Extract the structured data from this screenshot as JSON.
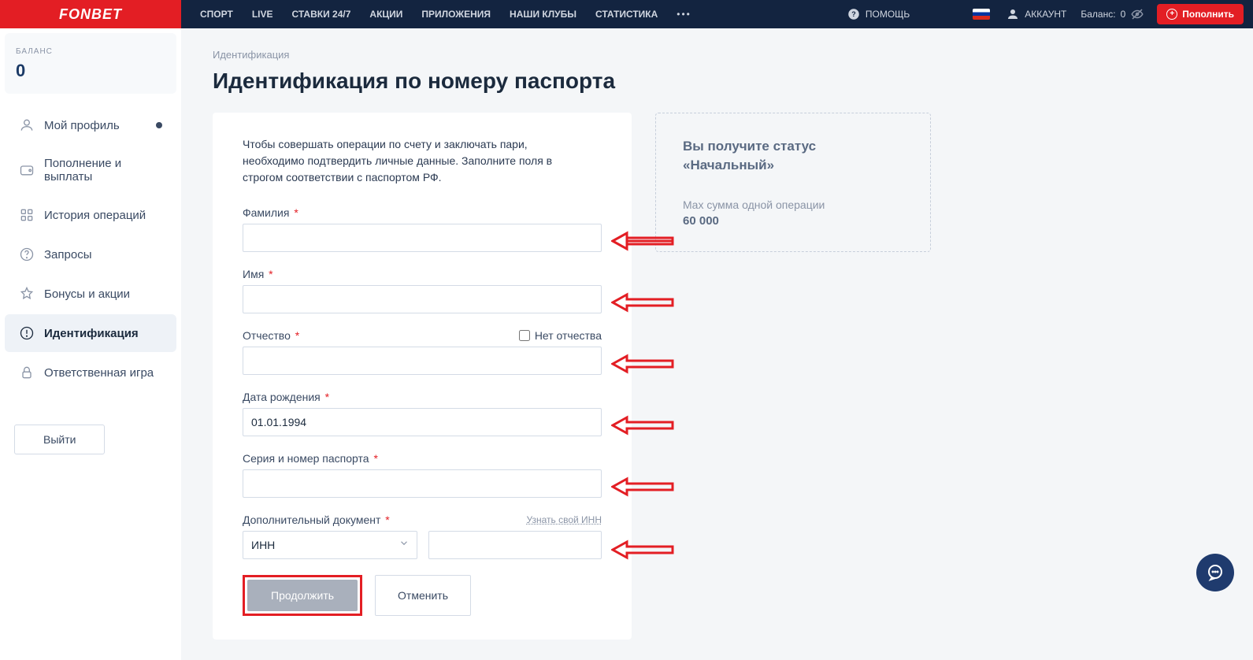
{
  "logo": "FONBET",
  "nav": {
    "items": [
      "СПОРТ",
      "LIVE",
      "СТАВКИ 24/7",
      "АКЦИИ",
      "ПРИЛОЖЕНИЯ",
      "НАШИ КЛУБЫ",
      "СТАТИСТИКА"
    ],
    "help": "ПОМОЩЬ",
    "account": "АККАУНТ",
    "balance_label": "Баланс:",
    "balance_value": "0",
    "refill": "Пополнить"
  },
  "sidebar": {
    "balance_label": "БАЛАНС",
    "balance_value": "0",
    "items": [
      {
        "label": "Мой профиль"
      },
      {
        "label": "Пополнение и выплаты"
      },
      {
        "label": "История операций"
      },
      {
        "label": "Запросы"
      },
      {
        "label": "Бонусы и акции"
      },
      {
        "label": "Идентификация"
      },
      {
        "label": "Ответственная игра"
      }
    ],
    "logout": "Выйти"
  },
  "main": {
    "breadcrumb": "Идентификация",
    "title": "Идентификация по номеру паспорта",
    "intro": "Чтобы совершать операции по счету и заключать пари, необходимо подтвердить личные данные. Заполните поля в строгом соответствии с паспортом РФ.",
    "fields": {
      "surname": {
        "label": "Фамилия",
        "value": ""
      },
      "name": {
        "label": "Имя",
        "value": ""
      },
      "patronymic": {
        "label": "Отчество",
        "value": "",
        "no_pat": "Нет отчества"
      },
      "dob": {
        "label": "Дата рождения",
        "value": "01.01.1994"
      },
      "passport": {
        "label": "Серия и номер паспорта",
        "value": ""
      },
      "doc": {
        "label": "Дополнительный документ",
        "value": "ИНН",
        "hint": "Узнать свой ИНН",
        "inn_value": ""
      }
    },
    "actions": {
      "continue": "Продолжить",
      "cancel": "Отменить"
    },
    "info": {
      "title": "Вы получите статус «Начальный»",
      "sub": "Max сумма одной операции",
      "value": "60 000"
    }
  }
}
